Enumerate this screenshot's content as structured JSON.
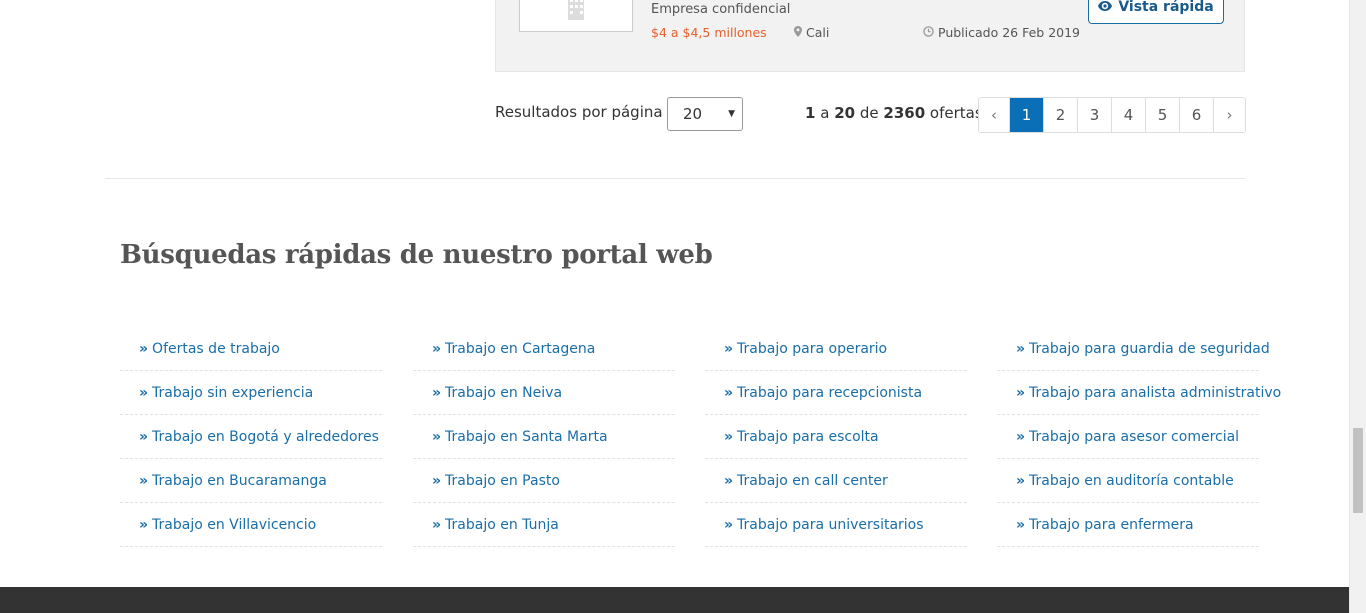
{
  "job_card": {
    "company": "Empresa confidencial",
    "salary": "$4 a $4,5 millones",
    "location": "Cali",
    "published": "Publicado 26 Feb 2019",
    "quick_view_label": "Vista rápida",
    "icons": [
      "building-icon",
      "map-marker-icon",
      "clock-icon",
      "eye-icon"
    ],
    "colors": {
      "salary": "#e8602c",
      "accent": "#1a6ea8"
    }
  },
  "pagination": {
    "per_page_label": "Resultados por página",
    "per_page_value": "20",
    "results": {
      "from": "1",
      "sep1": "a",
      "to": "20",
      "sep2": "de",
      "total": "2360",
      "unit": "ofertas"
    },
    "prev": "‹",
    "next": "›",
    "pages": [
      "1",
      "2",
      "3",
      "4",
      "5",
      "6"
    ],
    "current_page": "1",
    "active_color": "#0a6fb6"
  },
  "quick_searches": {
    "title": "Búsquedas rápidas de nuestro portal web",
    "bullet": "»",
    "columns": [
      [
        "Ofertas de trabajo",
        "Trabajo sin experiencia",
        "Trabajo en Bogotá y alrededores",
        "Trabajo en Bucaramanga",
        "Trabajo en Villavicencio"
      ],
      [
        "Trabajo en Cartagena",
        "Trabajo en Neiva",
        "Trabajo en Santa Marta",
        "Trabajo en Pasto",
        "Trabajo en Tunja"
      ],
      [
        "Trabajo para operario",
        "Trabajo para recepcionista",
        "Trabajo para escolta",
        "Trabajo en call center",
        "Trabajo para universitarios"
      ],
      [
        "Trabajo para guardia de seguridad",
        "Trabajo para analista administrativo",
        "Trabajo para asesor comercial",
        "Trabajo en auditoría contable",
        "Trabajo para enfermera"
      ]
    ]
  }
}
